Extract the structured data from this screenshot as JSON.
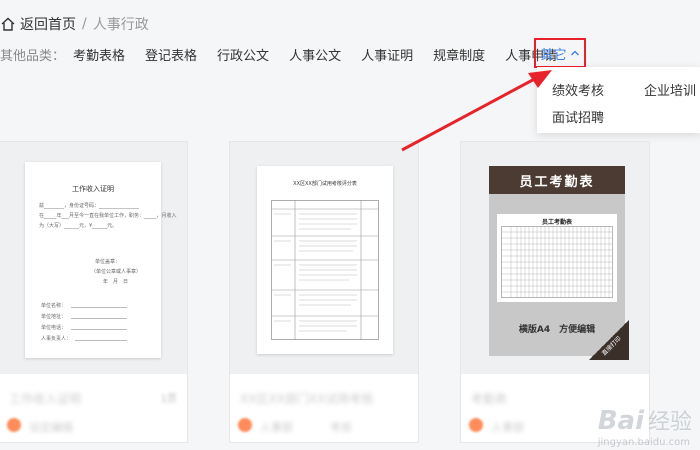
{
  "breadcrumb": {
    "home": "返回首页",
    "separator": "/",
    "current": "人事行政"
  },
  "filter": {
    "label": "其他品类：",
    "items": [
      "考勤表格",
      "登记表格",
      "行政公文",
      "人事公文",
      "人事证明",
      "规章制度",
      "人事申请"
    ],
    "more": "其它"
  },
  "dropdown": {
    "items": [
      "绩效考核",
      "企业培训",
      "面试招聘"
    ]
  },
  "cards": [
    {
      "title": "工作收入证明",
      "badge": "1页",
      "author": "设定编辑",
      "views": "",
      "doc": {
        "heading": "工作收入证明",
        "body1": "兹________，身份证号码：________________",
        "body2": "在_____年___月至今一直在我单位工作，职务：_____，月收入",
        "body3": "为（大写）______元，¥______元。",
        "sign1": "单位盖章：",
        "sign2": "（单位公章或人事章）",
        "date": "年　月　日",
        "f1": "单位名称：",
        "f2": "单位地址：",
        "f3": "单位电话：",
        "f4": "人事负责人："
      }
    },
    {
      "title": "XX区XX部门XX试用考核",
      "badge": "",
      "author": "人事部",
      "views": "考核",
      "doc": {
        "heading": "XX区XX部门试用考核评分表",
        "cols": [
          "考核内容",
          "评分标准",
          "得分"
        ]
      }
    },
    {
      "title": "考勤表",
      "badge": "",
      "author": "人事部",
      "views": "",
      "doc": {
        "banner": "员工考勤表",
        "sheet_title": "员工考勤表",
        "foot": "横版A4　方便编辑",
        "corner": "直接打印"
      }
    }
  ],
  "watermark": {
    "brand": "Bai",
    "sub": "经验",
    "url": "jingyan.baidu.com"
  }
}
